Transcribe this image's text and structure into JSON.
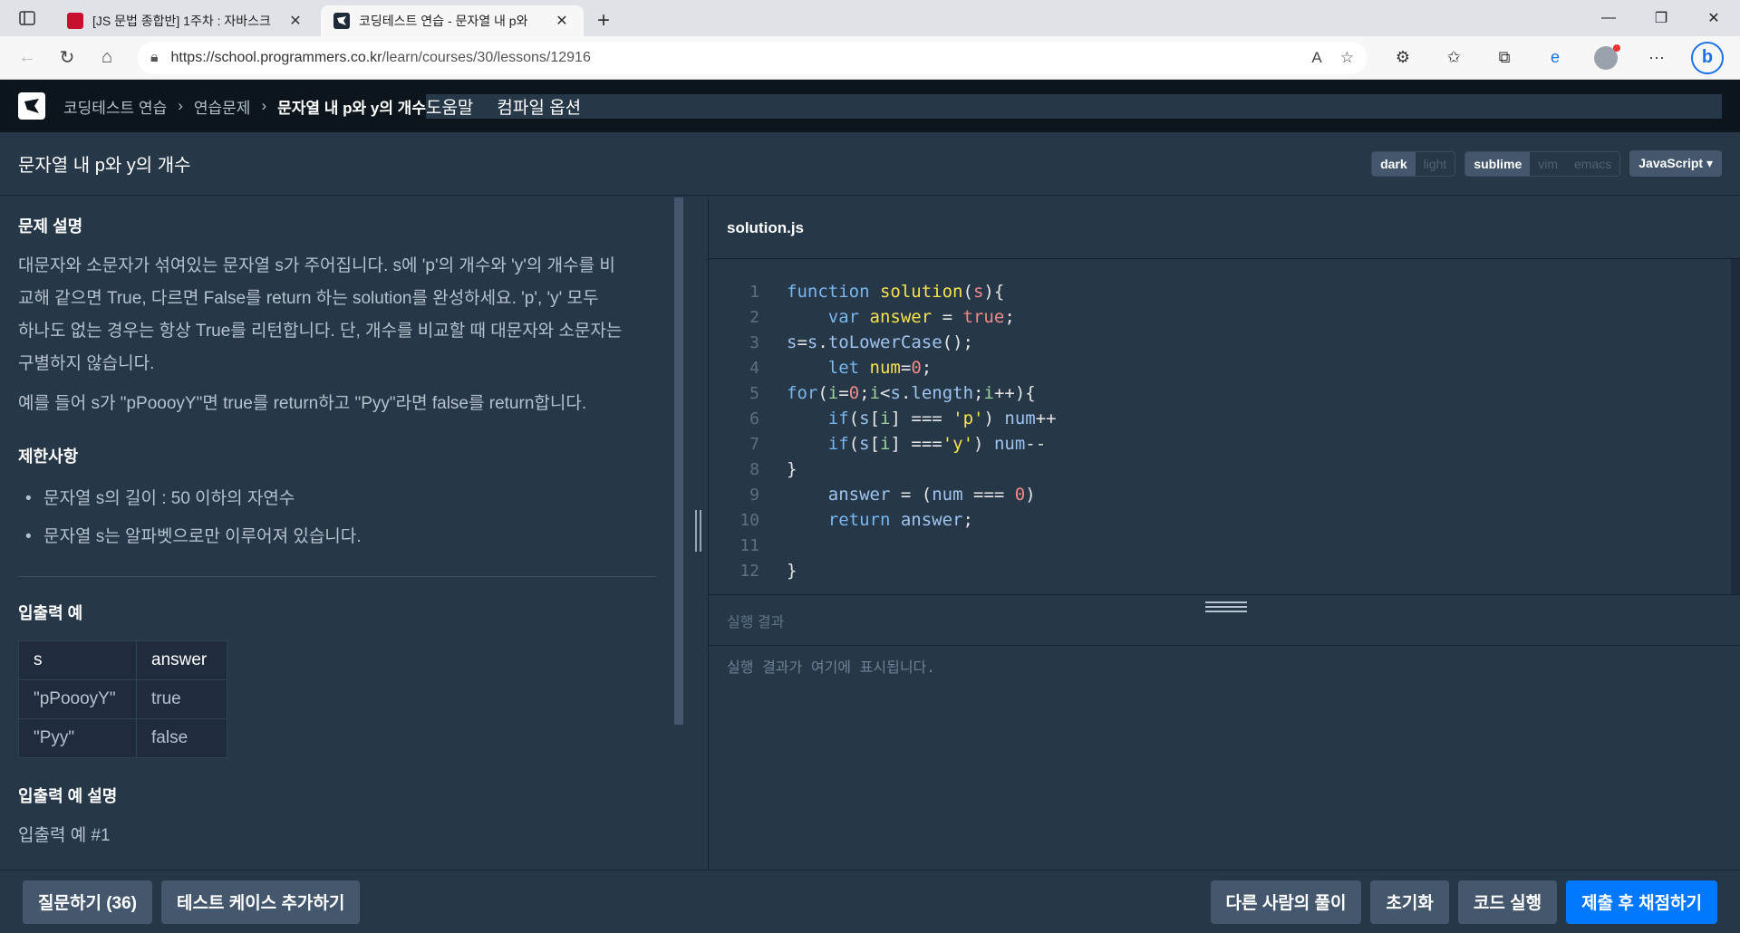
{
  "browser": {
    "tabs": [
      {
        "title": "[JS 문법 종합반] 1주차 : 자바스크",
        "active": false
      },
      {
        "title": "코딩테스트 연습 - 문자열 내 p와",
        "active": true
      }
    ],
    "url_host": "https://school.programmers.co.kr",
    "url_path": "/learn/courses/30/lessons/12916"
  },
  "header": {
    "crumbs": [
      "코딩테스트 연습",
      "연습문제"
    ],
    "current": "문자열 내 p와 y의 개수",
    "help": "도움말",
    "compile_options": "컴파일 옵션"
  },
  "titlebar": {
    "title": "문자열 내 p와 y의 개수",
    "theme": [
      "dark",
      "light"
    ],
    "keymap": [
      "sublime",
      "vim",
      "emacs"
    ],
    "language": "JavaScript"
  },
  "problem": {
    "desc_heading": "문제 설명",
    "desc_lines": [
      "대문자와 소문자가 섞여있는 문자열 s가 주어집니다. s에 'p'의 개수와 'y'의 개수를 비",
      "교해 같으면 True, 다르면 False를 return 하는 solution를 완성하세요. 'p', 'y' 모두",
      "하나도 없는 경우는 항상 True를 리턴합니다. 단, 개수를 비교할 때 대문자와 소문자는",
      "구별하지 않습니다."
    ],
    "example_line": "예를 들어 s가 \"pPoooyY\"면 true를 return하고 \"Pyy\"라면 false를 return합니다.",
    "constraints_heading": "제한사항",
    "constraints": [
      "문자열 s의 길이 : 50 이하의 자연수",
      "문자열 s는 알파벳으로만 이루어져 있습니다."
    ],
    "io_heading": "입출력 예",
    "io_columns": [
      "s",
      "answer"
    ],
    "io_rows": [
      [
        "\"pPoooyY\"",
        "true"
      ],
      [
        "\"Pyy\"",
        "false"
      ]
    ],
    "io_desc_heading": "입출력 예 설명",
    "io_desc_sub": "입출력 예 #1"
  },
  "editor": {
    "filename": "solution.js",
    "line_numbers": [
      "1",
      "2",
      "3",
      "4",
      "5",
      "6",
      "7",
      "8",
      "9",
      "10",
      "11",
      "12"
    ]
  },
  "result": {
    "heading": "실행 결과",
    "placeholder": "실행 결과가 여기에 표시됩니다."
  },
  "buttons": {
    "question": "질문하기 (36)",
    "add_testcase": "테스트 케이스 추가하기",
    "others": "다른 사람의 풀이",
    "reset": "초기화",
    "run": "코드 실행",
    "submit": "제출 후 채점하기"
  }
}
